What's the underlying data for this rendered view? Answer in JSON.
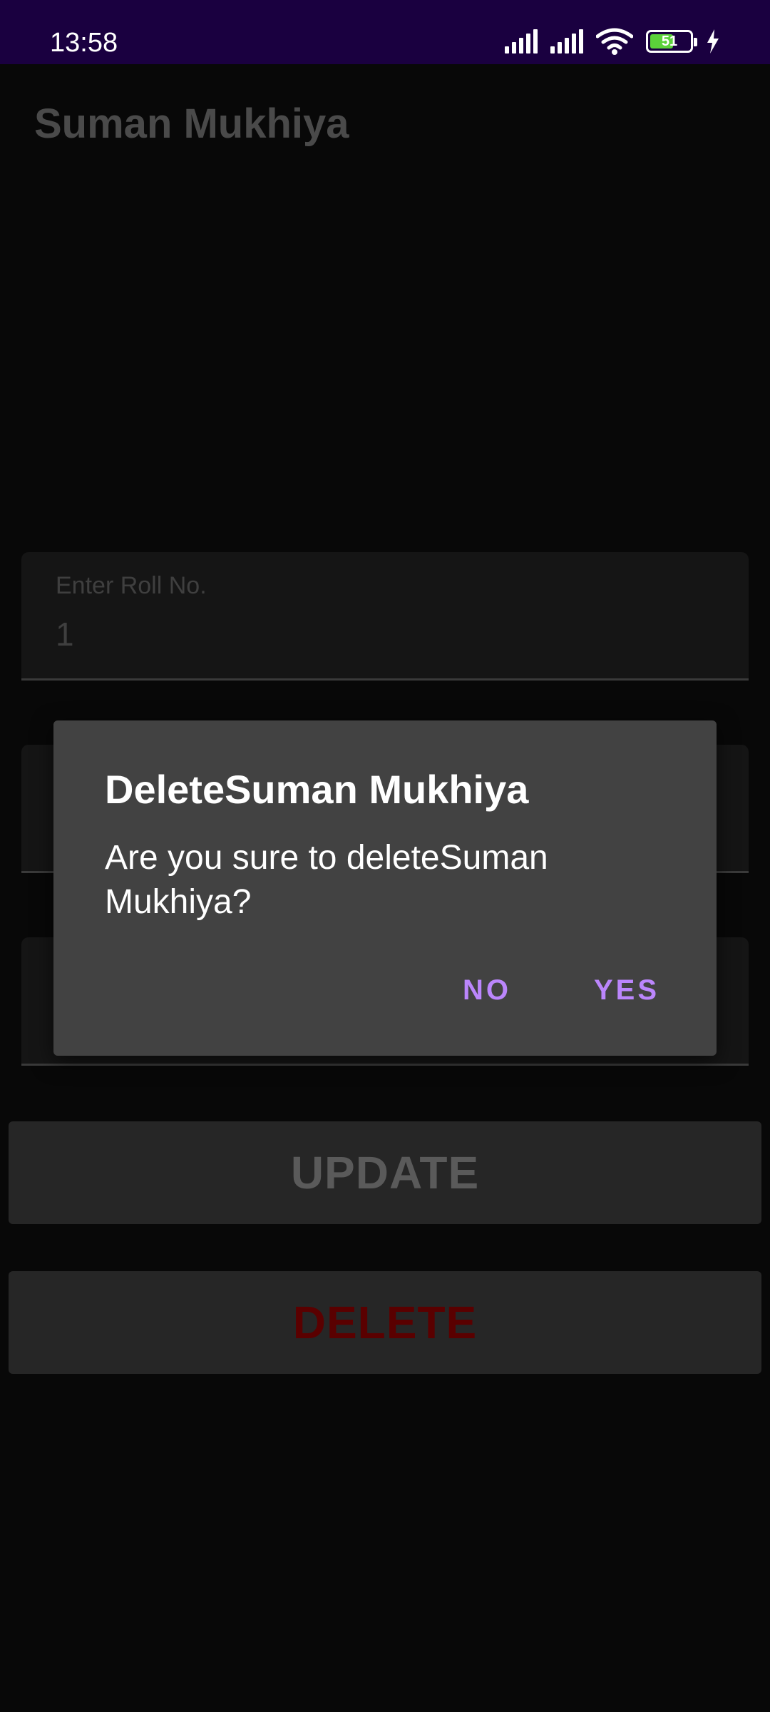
{
  "status_bar": {
    "time": "13:58",
    "battery_level": "51",
    "icons": [
      "signal-icon",
      "signal-icon",
      "wifi-icon",
      "battery-icon",
      "charging-icon"
    ]
  },
  "app_bar": {
    "title": "Suman Mukhiya"
  },
  "form": {
    "roll_no": {
      "label": "Enter Roll No.",
      "value": "1"
    }
  },
  "buttons": {
    "update_label": "UPDATE",
    "delete_label": "DELETE"
  },
  "dialog": {
    "title": "DeleteSuman Mukhiya",
    "message": "Are you sure to deleteSuman Mukhiya?",
    "no_label": "NO",
    "yes_label": "YES"
  },
  "colors": {
    "status_bar": "#1a0040",
    "accent": "#bb86fc",
    "dialog_bg": "#424242",
    "delete_text": "#5a0000"
  }
}
